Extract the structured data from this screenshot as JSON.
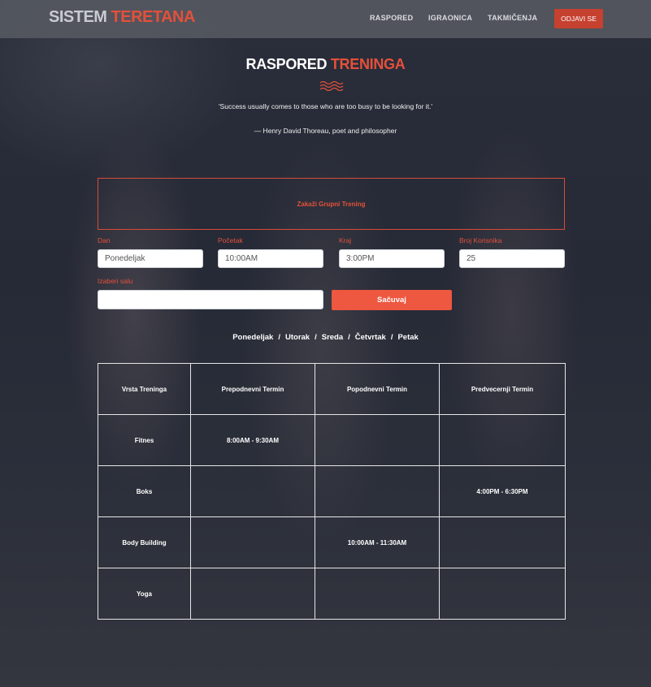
{
  "navbar": {
    "brand_part1": "SISTEM",
    "brand_part2": "TERETANA",
    "links": [
      "RASPORED",
      "IGRAONICA",
      "TAKMIČENJA"
    ],
    "logout_label": "ODJAVI SE"
  },
  "hero": {
    "title_part1": "RASPORED",
    "title_part2": "TRENINGA",
    "quote": "'Success usually comes to those who are too busy to be looking for it.'",
    "author": "— Henry David Thoreau, poet and philosopher"
  },
  "form": {
    "schedule_label": "Zakaži Grupni Trening",
    "day_label": "Dan",
    "day_value": "Ponedeljak",
    "start_label": "Početak",
    "start_value": "10:00AM",
    "end_label": "Kraj",
    "end_value": "3:00PM",
    "users_label": "Broj Korisnika",
    "users_value": "25",
    "room_label": "Izaberi salu",
    "room_value": "",
    "save_label": "Sačuvaj"
  },
  "days": [
    "Ponedeljak",
    "Utorak",
    "Sreda",
    "Četvrtak",
    "Petak"
  ],
  "table": {
    "headers": [
      "Vrsta Treninga",
      "Prepodnevni Termin",
      "Popodnevni Termin",
      "Predvecernji Termin"
    ],
    "rows": [
      [
        "Fitnes",
        "8:00AM - 9:30AM",
        "",
        ""
      ],
      [
        "Boks",
        "",
        "",
        "4:00PM - 6:30PM"
      ],
      [
        "Body Building",
        "",
        "10:00AM - 11:30AM",
        ""
      ],
      [
        "Yoga",
        "",
        "",
        ""
      ]
    ]
  },
  "colors": {
    "accent": "#e4503b",
    "button": "#ee5740",
    "navbar": "#55585f"
  }
}
